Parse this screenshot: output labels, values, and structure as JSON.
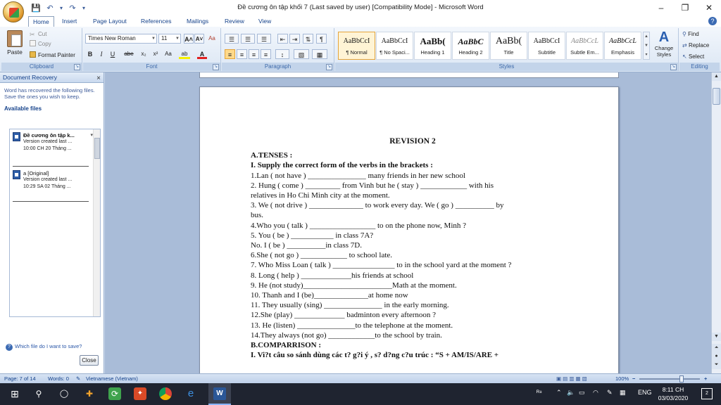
{
  "window": {
    "title": "Đề cương ôn tập khối 7 (Last saved by user) [Compatibility Mode] - Microsoft Word",
    "minimize": "–",
    "maximize": "❐",
    "close": "✕"
  },
  "quick_access": {
    "undo": "↶",
    "undo_dd": "▾",
    "redo": "↷",
    "save": "💾",
    "customize": "▾"
  },
  "tabs": [
    "Home",
    "Insert",
    "Page Layout",
    "References",
    "Mailings",
    "Review",
    "View"
  ],
  "help": "?",
  "clipboard": {
    "paste": "Paste",
    "cut": "Cut",
    "copy": "Copy",
    "format_painter": "Format Painter",
    "label": "Clipboard"
  },
  "font": {
    "family": "Times New Roman",
    "size": "11",
    "grow": "A˄",
    "shrink": "A˅",
    "clear": "Aa",
    "bold": "B",
    "italic": "I",
    "underline": "U",
    "strike": "abe",
    "subscript": "x₂",
    "superscript": "x²",
    "case": "Aa",
    "highlight": "ab",
    "font_color": "A",
    "label": "Font"
  },
  "paragraph": {
    "bullets": "☰",
    "numbering": "☰",
    "multilevel": "☰",
    "decrease_indent": "⇤",
    "increase_indent": "⇥",
    "sort": "⇅",
    "show_marks": "¶",
    "align_left": "≡",
    "align_center": "≡",
    "align_right": "≡",
    "justify": "≡",
    "line_spacing": "↕",
    "shading": "▧",
    "borders": "▦",
    "label": "Paragraph"
  },
  "styles": {
    "items": [
      {
        "sample": "AaBbCcI",
        "name": "¶ Normal"
      },
      {
        "sample": "AaBbCcI",
        "name": "¶ No Spaci..."
      },
      {
        "sample": "AaBb(",
        "name": "Heading 1"
      },
      {
        "sample": "AaBbC",
        "name": "Heading 2"
      },
      {
        "sample": "AaBb(",
        "name": "Title"
      },
      {
        "sample": "AaBbCcI",
        "name": "Subtitle"
      },
      {
        "sample": "AaBbCcL",
        "name": "Subtle Em..."
      },
      {
        "sample": "AaBbCcL",
        "name": "Emphasis"
      }
    ],
    "change_styles": "Change Styles",
    "label": "Styles"
  },
  "editing": {
    "find": "Find",
    "replace": "Replace",
    "select": "Select",
    "label": "Editing"
  },
  "recovery": {
    "header": "Document Recovery",
    "message": "Word has recovered the following files.  Save the ones you wish to keep.",
    "available": "Available files",
    "files": [
      {
        "name": "Đề cương ôn tập k...",
        "line1": "Version created last ...",
        "line2": "10:00 CH 20 Tháng ..."
      },
      {
        "name": "a  [Original]",
        "line1": "Version created last ...",
        "line2": "10:29 SA 02 Tháng ..."
      }
    ],
    "which": "Which file do I want to save?",
    "close": "Close"
  },
  "document": {
    "title": "REVISION 2",
    "lines": [
      {
        "text": "A.TENSES :",
        "bold": true
      },
      {
        "text": "I. Supply the correct form of the verbs in the brackets :",
        "bold": true
      },
      {
        "text": "1.Lan ( not have ) _______________ many friends in her new school",
        "bold": false
      },
      {
        "text": "2. Hung ( come ) _________ from Vinh but he ( stay ) ____________ with his",
        "bold": false
      },
      {
        "text": "relatives in Ho Chi Minh city at the moment.",
        "bold": false
      },
      {
        "text": "3. We ( not drive ) ______________ to work every day. We ( go ) __________ by",
        "bold": false
      },
      {
        "text": "bus.",
        "bold": false
      },
      {
        "text": "4.Who you ( talk ) _________________ to on the phone now, Minh ?",
        "bold": false
      },
      {
        "text": "5. You ( be ) ___________ in class 7A?",
        "bold": false
      },
      {
        "text": "No. I ( be ) __________in class 7D.",
        "bold": false
      },
      {
        "text": "6.She ( not go )   ____________ to school late.",
        "bold": false
      },
      {
        "text": "7. Who  Miss Loan ( talk ) ________________ to in the school yard at the moment ?",
        "bold": false
      },
      {
        "text": "8. Long  ( help ) _____________his friends at school",
        "bold": false
      },
      {
        "text": "9. He (not study)_______________________Math at the moment.",
        "bold": false
      },
      {
        "text": "10. Thanh and I (be)______________at home now",
        "bold": false
      },
      {
        "text": "11. They usually (sing) _______________ in the early morning.",
        "bold": false
      },
      {
        "text": "12.She (play) _____________ badminton every afternoon ?",
        "bold": false
      },
      {
        "text": "13. He (listen) _______________to the telephone at the moment.",
        "bold": false
      },
      {
        "text": "14.They always (not go) ____________to the school by train.",
        "bold": false
      },
      {
        "text": "B.COMPARRISON  :",
        "bold": true
      },
      {
        "text": "I. Vi?t câu so sánh dùng các t? g?i ý , s? d?ng c?u trúc : “S + AM/IS/ARE +",
        "bold": true
      }
    ]
  },
  "statusbar": {
    "page": "Page: 7 of 14",
    "words": "Words: 0",
    "language": "Vietnamese (Vietnam)",
    "zoom": "100%",
    "zoom_minus": "−",
    "zoom_plus": "+"
  },
  "taskbar": {
    "time": "8:11 CH",
    "date": "03/03/2020",
    "lang": "ENG",
    "notifications": "2"
  }
}
